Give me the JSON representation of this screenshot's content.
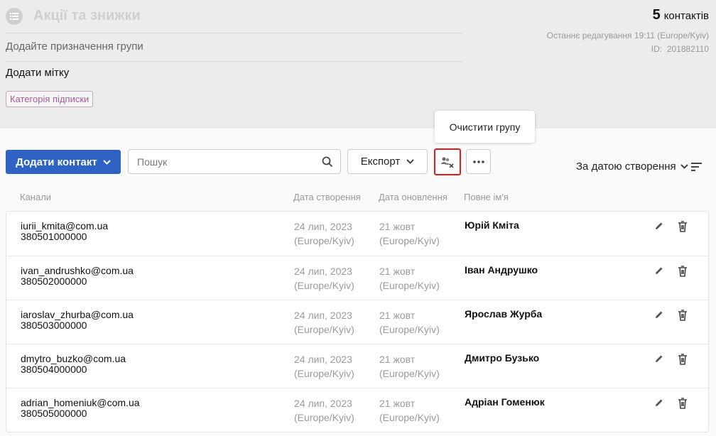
{
  "group": {
    "title": "Акції та знижки",
    "purpose_placeholder": "Додайте призначення групи",
    "add_tag": "Додати мітку",
    "chip": "Категорія підписки",
    "count": "5",
    "count_label": "контактів",
    "last_edit": "Останнє редагування 19:11 (Europe/Kyiv)",
    "id_label": "ID:",
    "id_value": "201882110"
  },
  "toolbar": {
    "add_contact": "Додати контакт",
    "search_placeholder": "Пошук",
    "export": "Експорт",
    "tooltip": "Очистити групу",
    "sort_label": "За датою створення"
  },
  "columns": {
    "channels": "Канали",
    "created": "Дата створення",
    "updated": "Дата оновлення",
    "fullname": "Повне ім'я"
  },
  "rows": [
    {
      "email": "iurii_kmita@com.ua",
      "phone": "380501000000",
      "created": "24 лип, 2023",
      "created_tz": "(Europe/Kyiv)",
      "updated": "21 жовт",
      "updated_tz": "(Europe/Kyiv)",
      "name": "Юрій Кміта"
    },
    {
      "email": "ivan_andrushko@com.ua",
      "phone": "380502000000",
      "created": "24 лип, 2023",
      "created_tz": "(Europe/Kyiv)",
      "updated": "21 жовт",
      "updated_tz": "(Europe/Kyiv)",
      "name": "Іван Андрушко"
    },
    {
      "email": "iaroslav_zhurba@com.ua",
      "phone": "380503000000",
      "created": "24 лип, 2023",
      "created_tz": "(Europe/Kyiv)",
      "updated": "21 жовт",
      "updated_tz": "(Europe/Kyiv)",
      "name": "Ярослав Журба"
    },
    {
      "email": "dmytro_buzko@com.ua",
      "phone": "380504000000",
      "created": "24 лип, 2023",
      "created_tz": "(Europe/Kyiv)",
      "updated": "21 жовт",
      "updated_tz": "(Europe/Kyiv)",
      "name": "Дмитро Бузько"
    },
    {
      "email": "adrian_homeniuk@com.ua",
      "phone": "380505000000",
      "created": "24 лип, 2023",
      "created_tz": "(Europe/Kyiv)",
      "updated": "21 жовт",
      "updated_tz": "(Europe/Kyiv)",
      "name": "Адріан Гоменюк"
    }
  ],
  "icons": {
    "group": "list-icon",
    "add_chevron": "chevron-down-icon",
    "search": "search-icon",
    "export_chevron": "chevron-down-icon",
    "clear_group": "users-remove-icon",
    "more": "more-horizontal-icon",
    "sort_chevron": "chevron-down-icon",
    "sort_order": "sort-lines-icon",
    "edit": "pencil-icon",
    "delete": "trash-icon"
  },
  "colors": {
    "primary": "#2f62c5",
    "highlight": "#e41b1b",
    "chip_text": "#a35c98",
    "header_bg": "#ececec"
  }
}
